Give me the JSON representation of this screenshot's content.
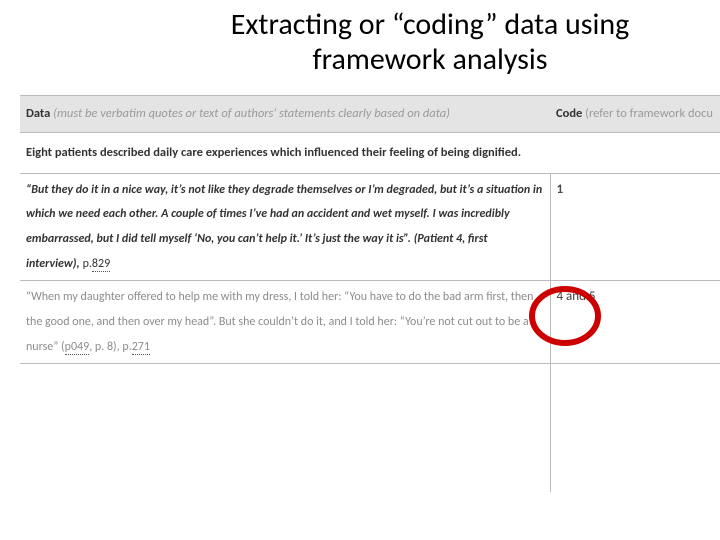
{
  "title": "Extracting or “coding” data using framework analysis",
  "table": {
    "header": {
      "data_strong": "Data",
      "data_grey": "(must be verbatim quotes or text of authors' statements clearly based on data)",
      "code_strong": "Code",
      "code_grey": "(refer to framework docu"
    },
    "summary": "Eight patients described daily care experiences which influenced their feeling of being dignified.",
    "rows": [
      {
        "quote": "“But they do it in a nice way, it’s not like they degrade themselves or I’m degraded, but it’s a situation in which we need each other. A couple of times I’ve had an accident and wet myself. I was incredibly embarrassed, but I did tell myself ‘No, you can’t help it.’ It’s just the way it is”. (Patient 4, first interview),",
        "page_label": "p.",
        "page_num": "829",
        "code": "1"
      },
      {
        "quote": "“When my daughter offered to help me with my dress, I told her: “You have to do the bad arm first, then the good one, and then over my head”. But she couldn’t do it, and I told her: “You’re not cut out to be a nurse” ",
        "pid_paren_open": "(",
        "pid_label": "p049",
        "pid_paren_close": ", p. 8),",
        "page_label2": " p.",
        "page_num2": "271",
        "code": "4 and 5"
      }
    ]
  },
  "annotation": {
    "name": "red-circle-highlight",
    "stroke": "#cc0000"
  }
}
